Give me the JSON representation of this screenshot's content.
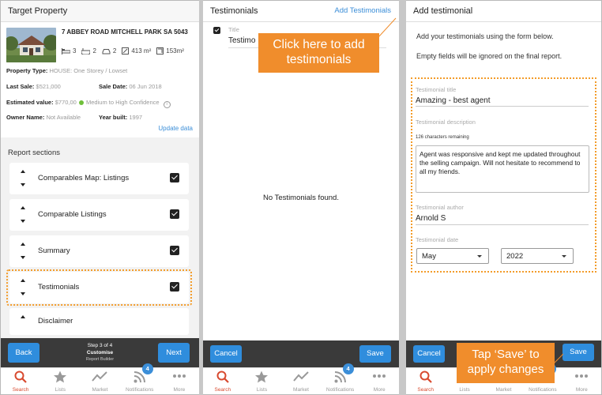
{
  "panel1": {
    "header_title": "Target Property",
    "address": "7 ABBEY ROAD MITCHELL PARK SA 5043",
    "features": {
      "beds": "3",
      "baths": "2",
      "cars": "2",
      "land": "413 m²",
      "floor": "153m²"
    },
    "property_type_label": "Property Type:",
    "property_type_value": "HOUSE: One Storey / Lowset",
    "last_sale_label": "Last Sale:",
    "last_sale_value": "$521,000",
    "sale_date_label": "Sale Date:",
    "sale_date_value": "06 Jun 2018",
    "estimated_label": "Estimated value:",
    "estimated_value": "$770,00",
    "confidence_text": "Medium to High Confidence",
    "owner_label": "Owner Name:",
    "owner_value": "Not Available",
    "year_label": "Year built:",
    "year_value": "1997",
    "update_link": "Update data",
    "sections_title": "Report sections",
    "sections": [
      {
        "label": "Comparables Map: Listings",
        "checked": true
      },
      {
        "label": "Comparable Listings",
        "checked": true
      },
      {
        "label": "Summary",
        "checked": true
      },
      {
        "label": "Testimonials",
        "checked": true
      },
      {
        "label": "Disclaimer",
        "checked": false
      }
    ],
    "back_label": "Back",
    "next_label": "Next",
    "step_line1": "Step 3 of 4",
    "step_line2": "Customise",
    "step_line3": "Report Builder"
  },
  "panel2": {
    "header_title": "Testimonials",
    "add_link": "Add Testimonials",
    "title_label": "Title",
    "title_value": "Testimo",
    "callout_line1": "Click here to add",
    "callout_line2": "testimonials",
    "empty_text": "No Testimonials found.",
    "cancel_label": "Cancel",
    "save_label": "Save"
  },
  "panel3": {
    "header_title": "Add testimonial",
    "intro1": "Add your testimonials using the form below.",
    "intro2": "Empty fields will be ignored on the final report.",
    "title_label": "Testimonial title",
    "title_value": "Amazing - best agent",
    "desc_label": "Testimonial description",
    "chars_remaining": "126 characters remaining",
    "desc_value": "Agent was responsive and kept me updated throughout the selling campaign. Will not hesitate to recommend to all my friends.",
    "author_label": "Testimonial author",
    "author_value": "Arnold S",
    "date_label": "Testimonial date",
    "month_value": "May",
    "year_value": "2022",
    "cancel_label": "Cancel",
    "save_label": "Save",
    "callout_line1": "Tap ‘Save’ to",
    "callout_line2": "apply changes"
  },
  "tabbar": {
    "items": [
      {
        "label": "Search",
        "icon": "search-icon"
      },
      {
        "label": "Lists",
        "icon": "star-icon"
      },
      {
        "label": "Market",
        "icon": "trend-icon"
      },
      {
        "label": "Notifications",
        "icon": "rss-icon"
      },
      {
        "label": "More",
        "icon": "more-icon"
      }
    ],
    "badge": "4"
  },
  "colors": {
    "accent": "#2f8ddd",
    "callout": "#f08d2c",
    "active_tab": "#d84a2f"
  }
}
